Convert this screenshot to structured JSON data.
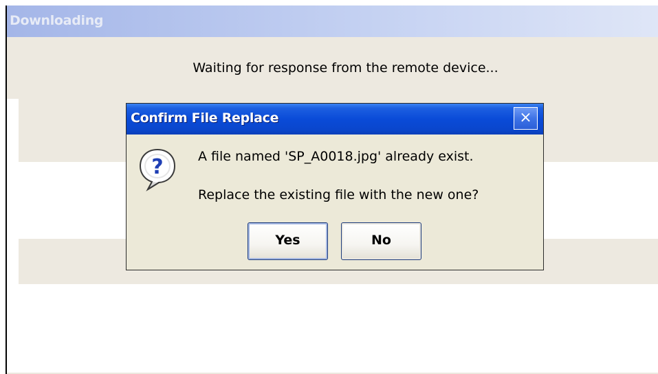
{
  "background_window": {
    "title": "Downloading",
    "message": "Waiting for response from the remote device..."
  },
  "dialog": {
    "title": "Confirm File Replace",
    "close_glyph": "×",
    "icon": "question-bubble-icon",
    "message_line1": "A file named 'SP_A0018.jpg' already exist.",
    "message_line2": "Replace the existing file with the new one?",
    "yes_label": "Yes",
    "no_label": "No"
  },
  "colors": {
    "dialog_title_blue": "#0a4bd8",
    "dialog_face": "#ece9d8",
    "background_title_faded": "#c4d1f2",
    "panel_beige": "#ede9e0"
  }
}
